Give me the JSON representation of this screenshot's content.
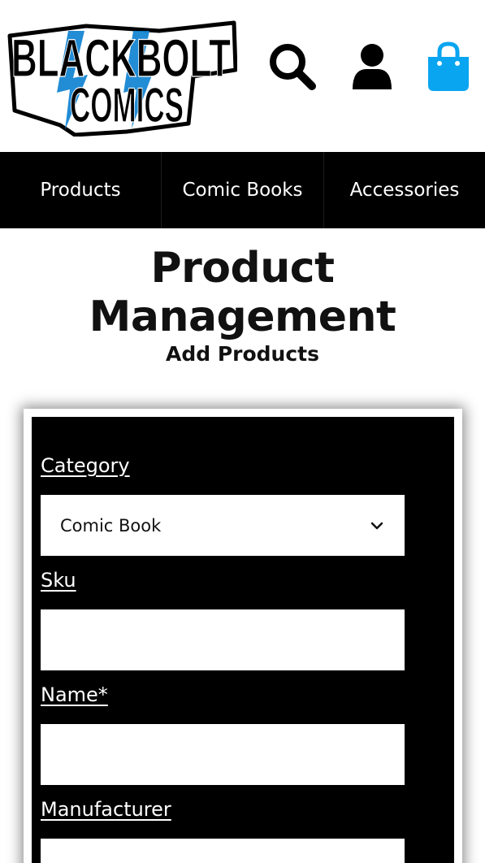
{
  "brand": {
    "logo_line1": "BLACKBOLT",
    "logo_line2": "COMICS",
    "accent_color": "#0a9be8"
  },
  "header_icons": [
    "search-icon",
    "user-icon",
    "shopping-bag-icon"
  ],
  "nav": {
    "items": [
      {
        "label": "Products"
      },
      {
        "label": "Comic Books"
      },
      {
        "label": "Accessories"
      }
    ]
  },
  "page": {
    "title": "Product Management",
    "section_title": "Add Products"
  },
  "form": {
    "category": {
      "label": "Category",
      "value": "Comic Book"
    },
    "sku": {
      "label": "Sku",
      "value": ""
    },
    "name": {
      "label": "Name*",
      "value": ""
    },
    "manufacturer": {
      "label": "Manufacturer",
      "value": ""
    }
  }
}
